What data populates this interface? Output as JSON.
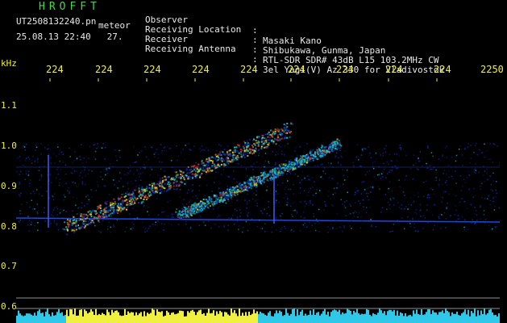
{
  "header": {
    "title": "HROFFT",
    "file_name": "UT2508132240.pn",
    "tag": "meteor",
    "datetime": "25.08.13 22:40   27."
  },
  "info": [
    {
      "label": "Observer",
      "value": "Masaki Kano"
    },
    {
      "label": "Receiving Location",
      "value": "Shibukawa, Gunma, Japan"
    },
    {
      "label": "Receiver",
      "value": "RTL-SDR SDR# 43dB L15 103.2MHz CW"
    },
    {
      "label": "Receiving Antenna",
      "value": "3el Yagi(V) Az 330 for Vladivostok"
    }
  ],
  "info_colon": ":",
  "axis": {
    "unit": "kHz",
    "y_ticks": [
      "1.1",
      "1.0",
      "0.9",
      "0.8",
      "0.7",
      "0.6"
    ],
    "x_ticks": [
      "224",
      "224",
      "224",
      "224",
      "224",
      "224",
      "224",
      "224",
      "224",
      "2250"
    ]
  },
  "colors": {
    "background": "#000000",
    "signal_low": "#1030c0",
    "signal_mid": "#10c0c0",
    "signal_high": "#e03020",
    "label_green": "#3ddc3d",
    "tick_yellow": "#f1f12e"
  }
}
